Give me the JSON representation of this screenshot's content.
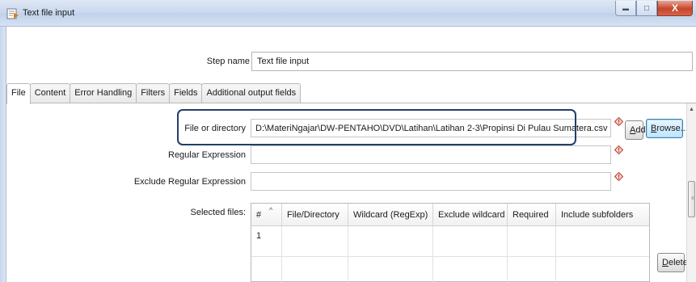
{
  "window": {
    "title": "Text file input",
    "min_symbol": "▬",
    "max_symbol": "□",
    "close_symbol": "X"
  },
  "step": {
    "label": "Step name",
    "value": "Text file input"
  },
  "tabs": [
    {
      "label": "File",
      "active": true
    },
    {
      "label": "Content"
    },
    {
      "label": "Error Handling"
    },
    {
      "label": "Filters"
    },
    {
      "label": "Fields"
    },
    {
      "label": "Additional output fields"
    }
  ],
  "file_tab": {
    "file_or_directory": {
      "label": "File or directory",
      "value": "D:\\MateriNgajar\\DW-PENTAHO\\DVD\\Latihan\\Latihan 2-3\\Propinsi Di Pulau Sumatera.csv"
    },
    "regular_expression": {
      "label": "Regular Expression",
      "value": ""
    },
    "exclude_regular_expression": {
      "label": "Exclude Regular Expression",
      "value": ""
    },
    "add_button": {
      "mnemonic": "A",
      "rest": "dd"
    },
    "browse_button": {
      "mnemonic": "B",
      "rest": "rowse..."
    },
    "delete_button": {
      "mnemonic": "D",
      "rest": "elete"
    },
    "selected_files": {
      "label": "Selected files:",
      "columns": [
        "#",
        "File/Directory",
        "Wildcard (RegExp)",
        "Exclude wildcard",
        "Required",
        "Include subfolders"
      ],
      "sort_indicator": "^",
      "rows": [
        [
          "1",
          "",
          "",
          "",
          "",
          ""
        ]
      ]
    }
  },
  "colors": {
    "highlight_border": "#1f3f6a",
    "warning_icon": "#c0392b",
    "close_button": "#c7452a"
  },
  "icons": {
    "title": "spoon-step-icon",
    "warning": "warning-diamond-icon"
  }
}
